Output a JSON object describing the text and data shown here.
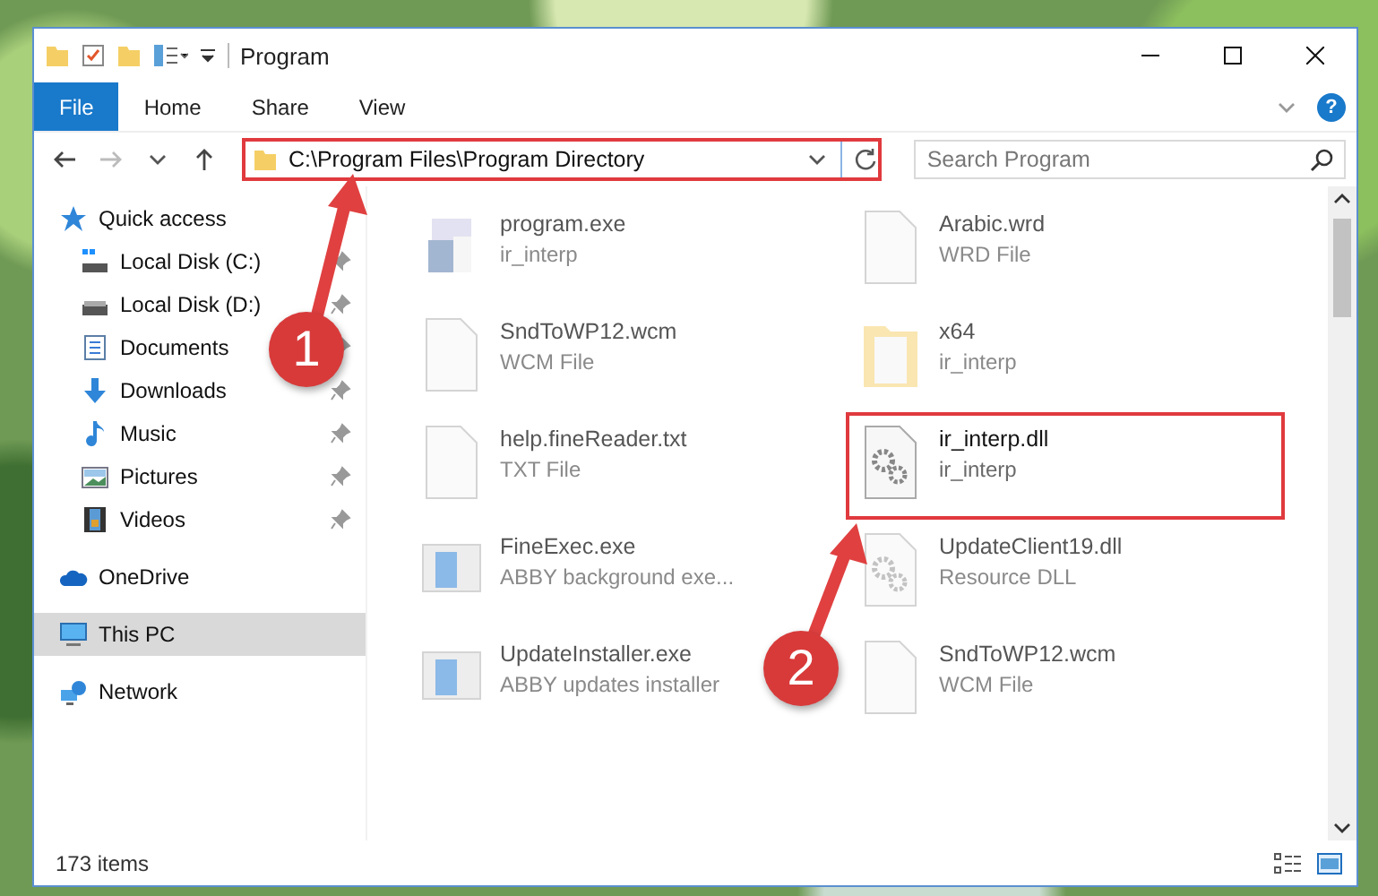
{
  "window": {
    "title": "Program"
  },
  "ribbon": {
    "tabs": [
      {
        "label": "File",
        "selected": true
      },
      {
        "label": "Home",
        "selected": false
      },
      {
        "label": "Share",
        "selected": false
      },
      {
        "label": "View",
        "selected": false
      }
    ],
    "help": "?"
  },
  "address_bar": {
    "path": "C:\\Program Files\\Program Directory",
    "highlighted": true
  },
  "search": {
    "placeholder": "Search Program"
  },
  "sidebar": {
    "items": [
      {
        "label": "Quick access",
        "kind": "star",
        "selected": false,
        "children": [
          {
            "label": "Local Disk (C:)",
            "kind": "diskc",
            "pinned": true,
            "selected": false
          },
          {
            "label": "Local Disk (D:)",
            "kind": "disk",
            "pinned": true,
            "selected": false
          },
          {
            "label": "Documents",
            "kind": "documents",
            "pinned": true,
            "selected": false
          },
          {
            "label": "Downloads",
            "kind": "downloads",
            "pinned": true,
            "selected": false
          },
          {
            "label": "Music",
            "kind": "music",
            "pinned": true,
            "selected": false
          },
          {
            "label": "Pictures",
            "kind": "pictures",
            "pinned": true,
            "selected": false
          },
          {
            "label": "Videos",
            "kind": "videos",
            "pinned": true,
            "selected": false
          }
        ]
      },
      {
        "label": "OneDrive",
        "kind": "cloud",
        "selected": false
      },
      {
        "label": "This PC",
        "kind": "pc",
        "selected": true
      },
      {
        "label": "Network",
        "kind": "network",
        "selected": false
      }
    ]
  },
  "files": [
    {
      "name": "program.exe",
      "type": "ir_interp",
      "kind": "setup",
      "blurred": true,
      "highlighted": false
    },
    {
      "name": "Arabic.wrd",
      "type": "WRD File",
      "kind": "doc",
      "blurred": true,
      "highlighted": false
    },
    {
      "name": "SndToWP12.wcm",
      "type": "WCM File",
      "kind": "doc",
      "blurred": true,
      "highlighted": false
    },
    {
      "name": "x64",
      "type": "ir_interp",
      "kind": "folder",
      "blurred": true,
      "highlighted": false
    },
    {
      "name": "help.fineReader.txt",
      "type": "TXT File",
      "kind": "doc",
      "blurred": true,
      "highlighted": false
    },
    {
      "name": "ir_interp.dll",
      "type": "ir_interp",
      "kind": "dll",
      "blurred": false,
      "highlighted": true
    },
    {
      "name": "FineExec.exe",
      "type": "ABBY background exe...",
      "kind": "app",
      "blurred": true,
      "highlighted": false
    },
    {
      "name": "UpdateClient19.dll",
      "type": "Resource DLL",
      "kind": "dll",
      "blurred": true,
      "highlighted": false
    },
    {
      "name": "UpdateInstaller.exe",
      "type": "ABBY updates installer",
      "kind": "app",
      "blurred": true,
      "highlighted": false
    },
    {
      "name": "SndToWP12.wcm",
      "type": "WCM File",
      "kind": "doc",
      "blurred": true,
      "highlighted": false
    }
  ],
  "status_bar": {
    "count": "173 items"
  },
  "callouts": [
    {
      "number": "1"
    },
    {
      "number": "2"
    }
  ]
}
